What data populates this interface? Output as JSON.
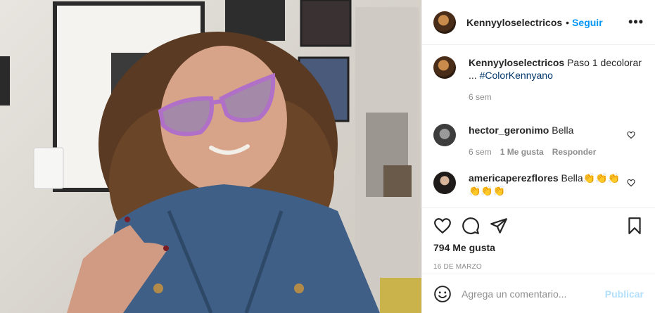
{
  "post": {
    "username": "Kennyyloselectricos",
    "follow_label": "Seguir",
    "more_label": "•••",
    "caption": {
      "username": "Kennyyloselectricos",
      "text": "Paso 1 decolorar",
      "ellipsis": "...",
      "hashtag": "#ColorKennyano",
      "age": "6 sem"
    },
    "comments": [
      {
        "username": "hector_geronimo",
        "text": "Bella",
        "age": "6 sem",
        "likes": "1 Me gusta",
        "reply": "Responder"
      },
      {
        "username": "americaperezflores",
        "text": "Bella👏👏👏",
        "text2": "👏👏👏"
      }
    ],
    "likes": "794 Me gusta",
    "date": "16 DE MARZO",
    "add_comment_placeholder": "Agrega un comentario...",
    "publish_label": "Publicar"
  },
  "colors": {
    "link": "#0095f6",
    "hashtag": "#00376b",
    "muted": "#8e8e8e",
    "publish_disabled": "#b2dffc"
  },
  "icons": [
    "heart-icon",
    "comment-icon",
    "share-icon",
    "bookmark-icon",
    "emoji-icon",
    "more-icon"
  ]
}
